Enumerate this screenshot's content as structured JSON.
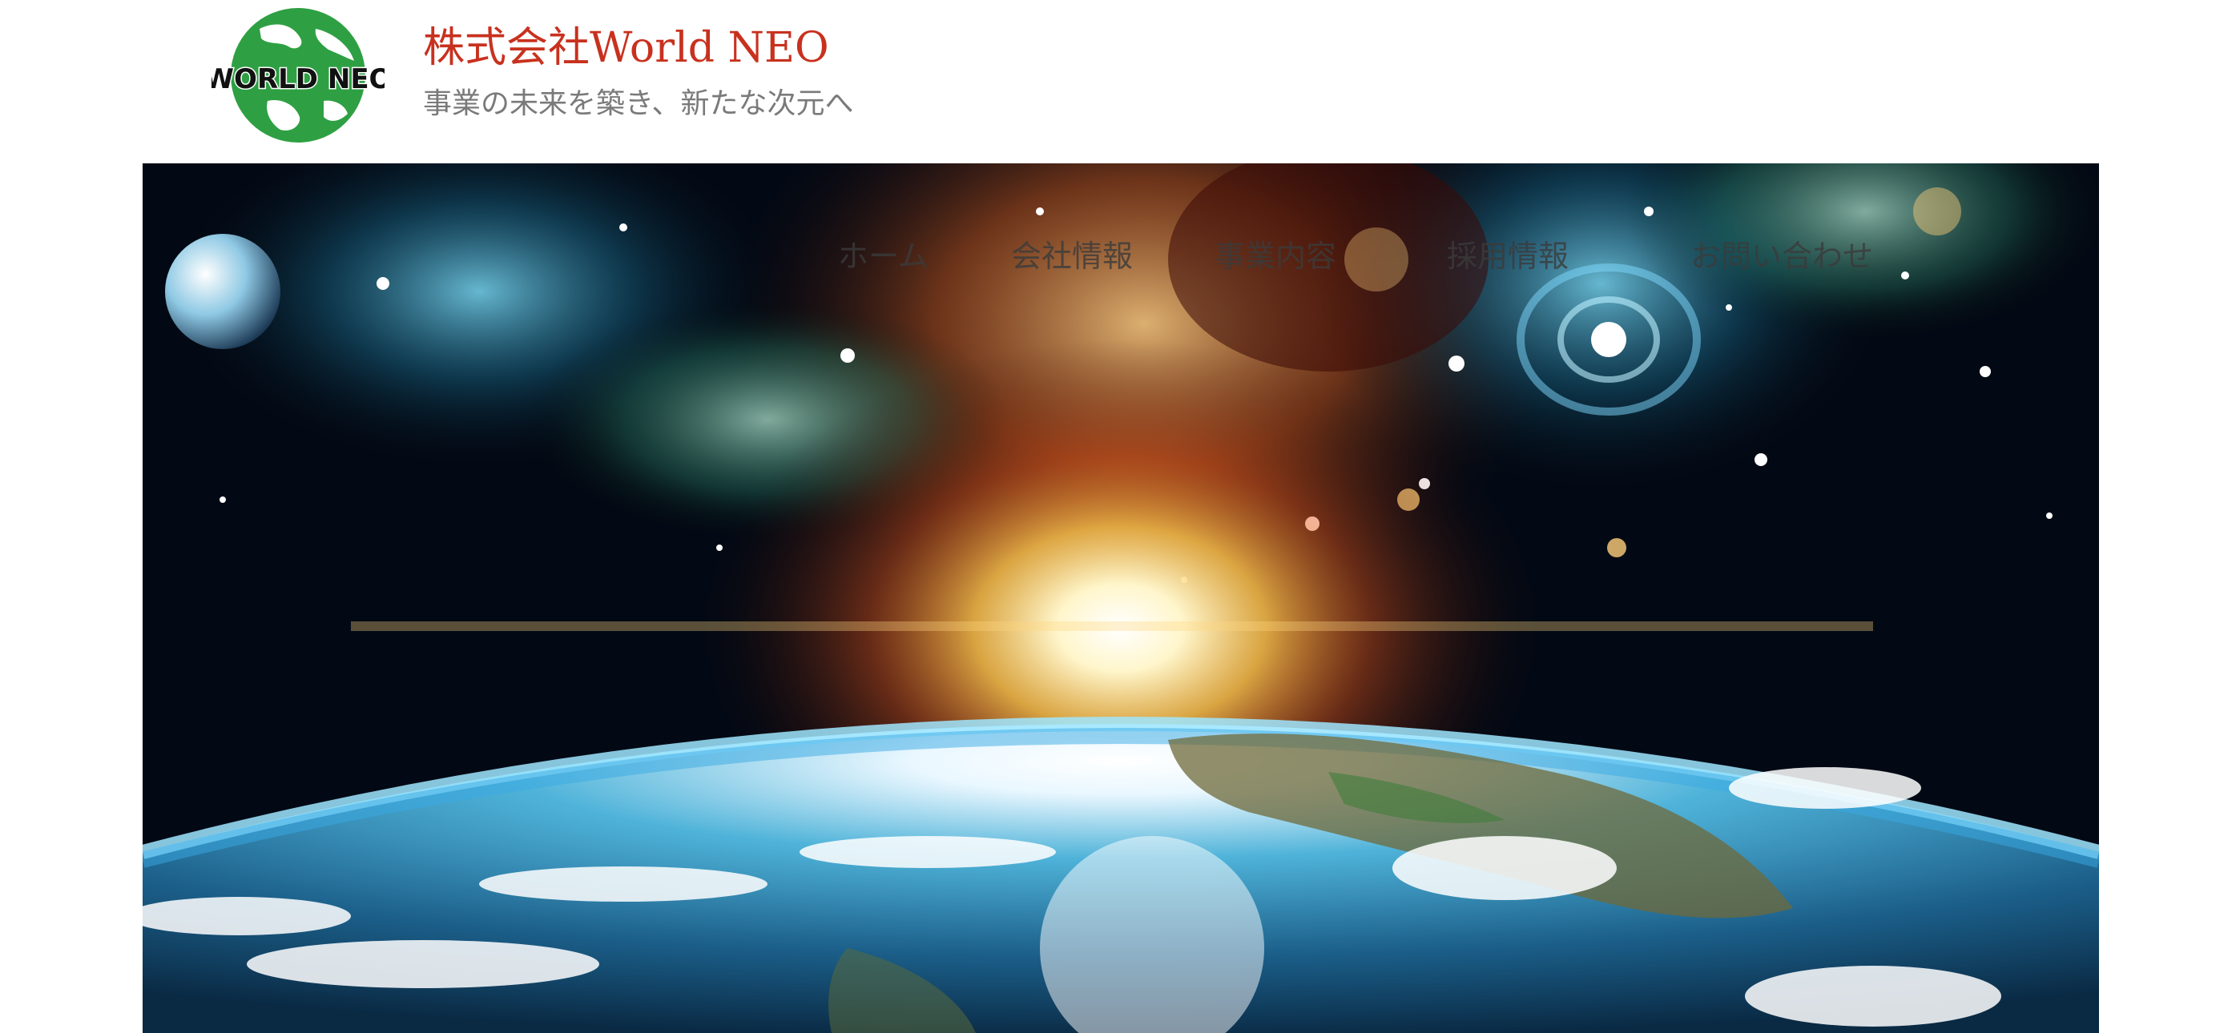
{
  "header": {
    "logo_text": "WORLD NEO",
    "title": "株式会社World NEO",
    "tagline": "事業の未来を築き、新たな次元へ"
  },
  "nav": {
    "items": [
      {
        "label": "ホーム"
      },
      {
        "label": "会社情報"
      },
      {
        "label": "事業内容"
      },
      {
        "label": "採用情報"
      },
      {
        "label": "お問い合わせ"
      }
    ]
  },
  "hero": {
    "image": "space-earth-sunrise"
  },
  "colors": {
    "title": "#c8311e",
    "tagline": "#7a7a7a",
    "logo_green": "#2ea043"
  }
}
